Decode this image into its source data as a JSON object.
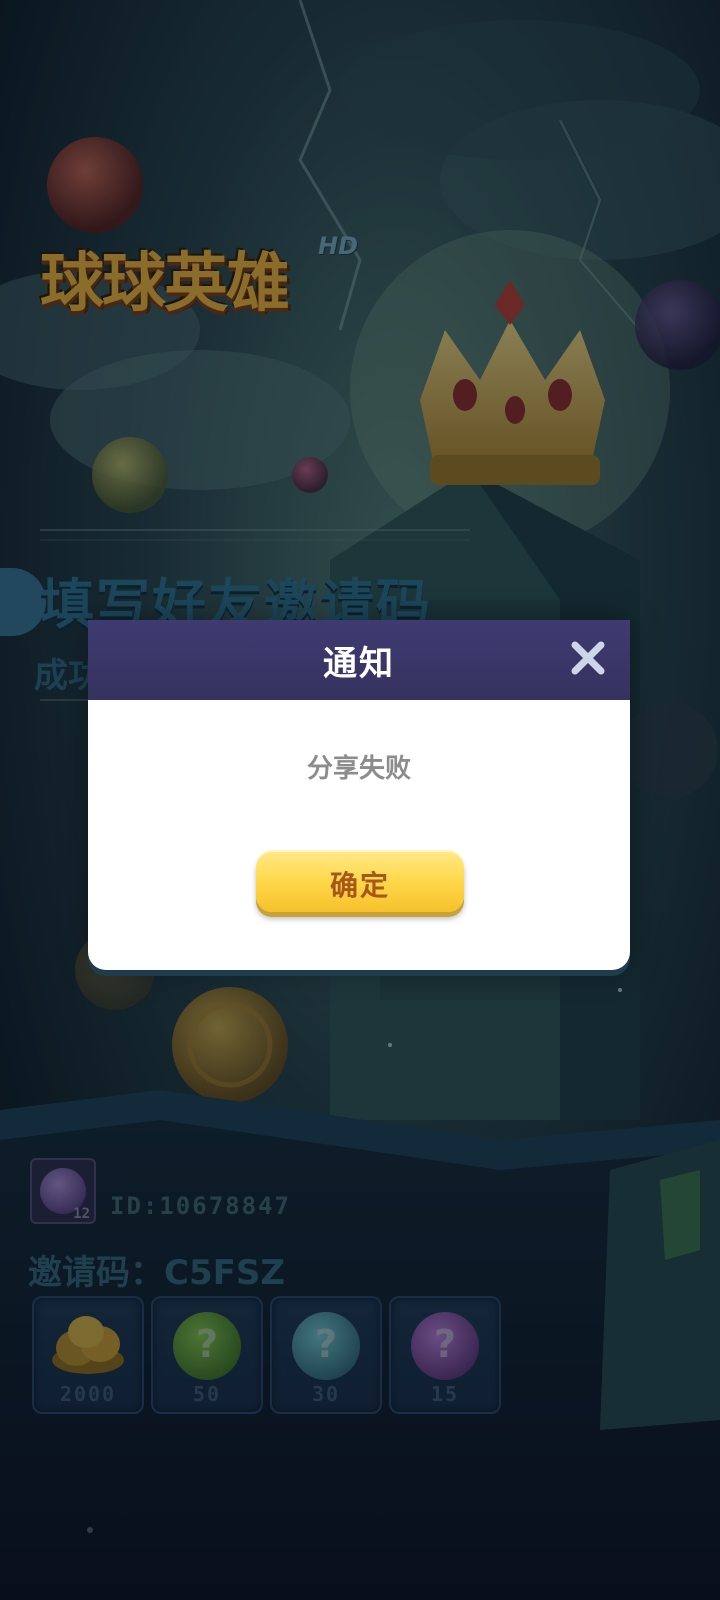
{
  "game": {
    "logo_main": "球球",
    "logo_secondary": "英雄",
    "logo_badge": "HD"
  },
  "banner": {
    "title": "填写好友邀请码",
    "subtitle_partial": "成功"
  },
  "player": {
    "avatar_level": "12",
    "id_text": "ID:10678847",
    "invite_label": "邀请码：",
    "invite_code": "C5FSZ"
  },
  "rewards": [
    {
      "icon": "gold-coins-icon",
      "amount": "2000"
    },
    {
      "icon": "green-mystery-orb-icon",
      "amount": "50",
      "mark": "?"
    },
    {
      "icon": "teal-mystery-orb-icon",
      "amount": "30",
      "mark": "?"
    },
    {
      "icon": "purple-mystery-orb-icon",
      "amount": "15",
      "mark": "?"
    }
  ],
  "dialog": {
    "title": "通知",
    "message": "分享失败",
    "confirm_label": "确定",
    "close_icon": "close-icon"
  },
  "colors": {
    "dialog_header": "#3f3b72",
    "confirm_button": "#ffd84a",
    "confirm_text": "#a7571c",
    "message_text": "#8c8c8c"
  }
}
